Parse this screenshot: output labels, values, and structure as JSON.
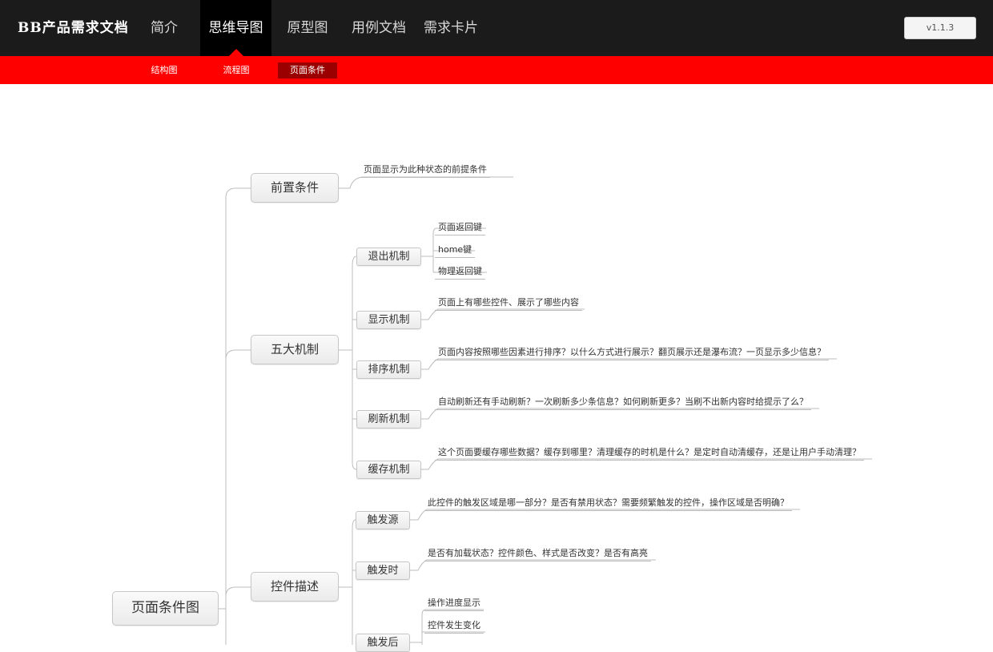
{
  "header": {
    "logo": "BB产品需求文档",
    "nav": [
      {
        "label": "简介"
      },
      {
        "label": "思维导图"
      },
      {
        "label": "原型图"
      },
      {
        "label": "用例文档"
      },
      {
        "label": "需求卡片"
      }
    ],
    "version": "v1.1.3"
  },
  "subnav": [
    {
      "label": "结构图"
    },
    {
      "label": "流程图"
    },
    {
      "label": "页面条件"
    }
  ],
  "mindmap": {
    "root": "页面条件图",
    "branches": [
      {
        "label": "前置条件",
        "leaves": [
          "页面显示为此种状态的前提条件"
        ]
      },
      {
        "label": "五大机制",
        "children": [
          {
            "label": "退出机制",
            "leaves": [
              "页面返回键",
              "home键",
              "物理返回键"
            ]
          },
          {
            "label": "显示机制",
            "leaves": [
              "页面上有哪些控件、展示了哪些内容"
            ]
          },
          {
            "label": "排序机制",
            "leaves": [
              "页面内容按照哪些因素进行排序？以什么方式进行展示？翻页展示还是瀑布流？一页显示多少信息？"
            ]
          },
          {
            "label": "刷新机制",
            "leaves": [
              "自动刷新还有手动刷新？一次刷新多少条信息？如何刷新更多？当刷不出新内容时给提示了么？"
            ]
          },
          {
            "label": "缓存机制",
            "leaves": [
              "这个页面要缓存哪些数据？缓存到哪里？清理缓存的时机是什么？是定时自动清缓存，还是让用户手动清理？"
            ]
          }
        ]
      },
      {
        "label": "控件描述",
        "children": [
          {
            "label": "触发源",
            "leaves": [
              "此控件的触发区域是哪一部分？是否有禁用状态？需要频繁触发的控件，操作区域是否明确？"
            ]
          },
          {
            "label": "触发时",
            "leaves": [
              "是否有加载状态？控件颜色、样式是否改变？是否有高亮"
            ]
          },
          {
            "label": "触发后",
            "leaves": [
              "操作进度显示",
              "控件发生变化"
            ]
          }
        ]
      }
    ]
  }
}
